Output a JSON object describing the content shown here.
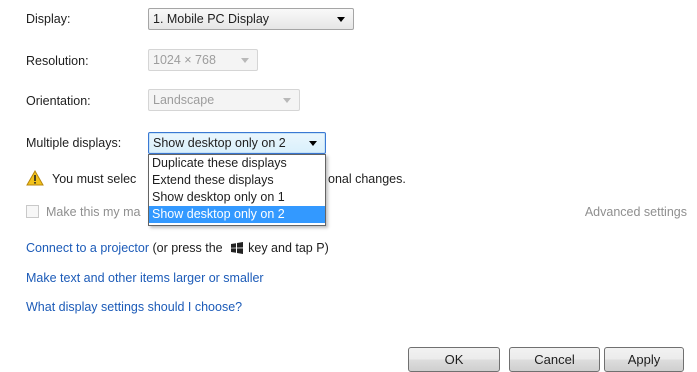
{
  "fields": {
    "display": {
      "label": "Display:",
      "value": "1. Mobile PC Display"
    },
    "resolution": {
      "label": "Resolution:",
      "value": "1024 × 768"
    },
    "orientation": {
      "label": "Orientation:",
      "value": "Landscape"
    },
    "multiple_displays": {
      "label": "Multiple displays:",
      "value": "Show desktop only on 2",
      "options": [
        "Duplicate these displays",
        "Extend these displays",
        "Show desktop only on 1",
        "Show desktop only on 2"
      ],
      "selected_index": 3
    }
  },
  "warning": {
    "text_before": "You must selec",
    "text_after": "onal changes."
  },
  "checkbox": {
    "label": "Make this my ma",
    "checked": false
  },
  "advanced_settings": "Advanced settings",
  "links": {
    "projector_link": "Connect to a projector",
    "projector_rest_before": " (or press the",
    "projector_rest_after": "key and tap P)",
    "larger_text": "Make text and other items larger or smaller",
    "which_settings": "What display settings should I choose?"
  },
  "buttons": {
    "ok": "OK",
    "cancel": "Cancel",
    "apply": "Apply"
  },
  "icons": {
    "warning": "warning-icon",
    "windows_key": "windows-logo-icon"
  },
  "colors": {
    "link": "#1c5bb8",
    "selection": "#3399ff",
    "warning": "#f2c21b"
  }
}
